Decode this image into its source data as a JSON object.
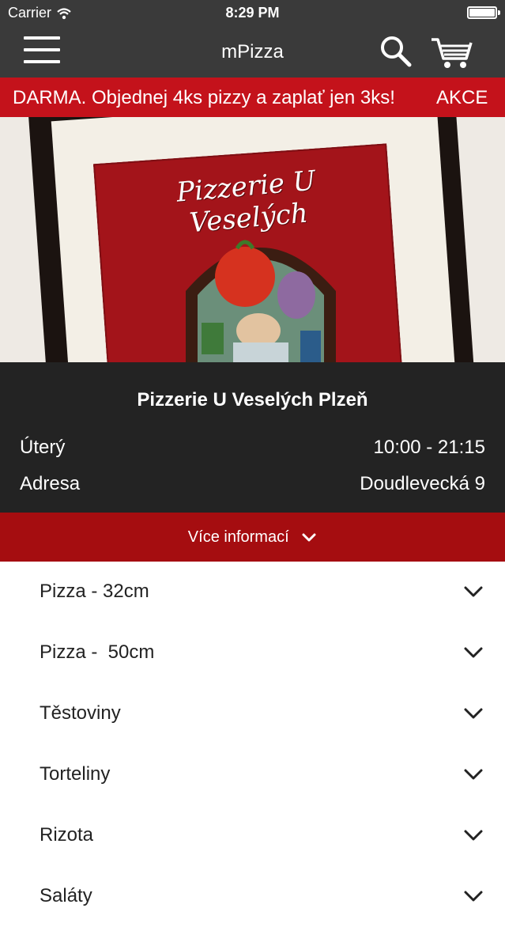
{
  "status_bar": {
    "carrier": "Carrier",
    "time": "8:29 PM",
    "wifi_icon": "wifi-icon",
    "battery_icon": "battery-icon"
  },
  "nav_bar": {
    "title": "mPizza",
    "menu_icon": "hamburger-menu-icon",
    "search_icon": "search-icon",
    "cart_icon": "cart-icon"
  },
  "promo": {
    "text": "DARMA. Objednej 4ks pizzy a zaplať jen 3ks!",
    "text_next": "AKCE"
  },
  "hero": {
    "sign_text": "Pizzerie U Veselých"
  },
  "info": {
    "title": "Pizzerie U Veselých Plzeň",
    "rows": [
      {
        "label": "Úterý",
        "value": "10:00 - 21:15"
      },
      {
        "label": "Adresa",
        "value": "Doudlevecká 9"
      }
    ]
  },
  "more_info": {
    "label": "Více informací",
    "icon": "chevron-down-icon"
  },
  "categories": [
    {
      "label": "Pizza - 32cm"
    },
    {
      "label": "Pizza -  50cm"
    },
    {
      "label": "Těstoviny"
    },
    {
      "label": "Torteliny"
    },
    {
      "label": "Rizota"
    },
    {
      "label": "Saláty"
    }
  ],
  "colors": {
    "header_bg": "#3a3a3a",
    "promo_bg": "#c4121b",
    "info_bg": "#232323",
    "more_info_bg": "#a50d10"
  }
}
